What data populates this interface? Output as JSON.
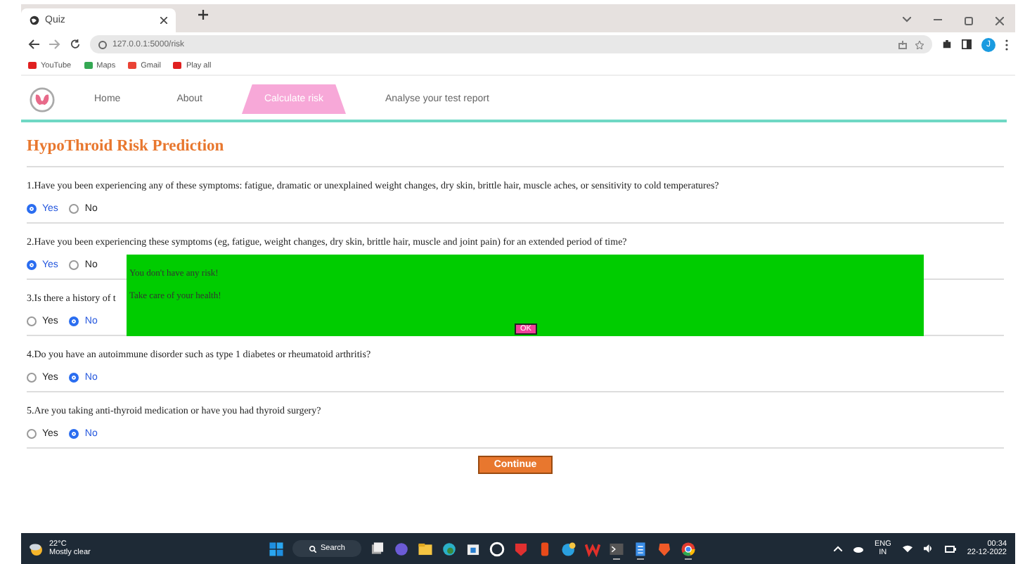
{
  "browser": {
    "tab_title": "Quiz",
    "url": "127.0.0.1:5000/risk",
    "bookmarks": [
      "YouTube",
      "Maps",
      "Gmail",
      "Play all"
    ],
    "profile_initial": "J"
  },
  "nav": {
    "items": [
      {
        "label": "Home",
        "selected": false
      },
      {
        "label": "About",
        "selected": false
      },
      {
        "label": "Calculate risk",
        "selected": true
      },
      {
        "label": "Analyse your test report",
        "selected": false
      }
    ]
  },
  "heading": "HypoThroid Risk Prediction",
  "questions": [
    {
      "text": "1.Have you been experiencing any of these symptoms: fatigue, dramatic or unexplained weight changes, dry skin, brittle hair, muscle aches, or sensitivity to cold temperatures?",
      "options": [
        {
          "label": "Yes",
          "selected": true
        },
        {
          "label": "No",
          "selected": false
        }
      ]
    },
    {
      "text": "2.Have you been experiencing these symptoms (eg, fatigue, weight changes, dry skin, brittle hair, muscle and joint pain) for an extended period of time?",
      "options": [
        {
          "label": "Yes",
          "selected": true
        },
        {
          "label": "No",
          "selected": false
        }
      ]
    },
    {
      "text": "3.Is there a history of t",
      "options": [
        {
          "label": "Yes",
          "selected": false
        },
        {
          "label": "No",
          "selected": true
        }
      ]
    },
    {
      "text": "4.Do you have an autoimmune disorder such as type 1 diabetes or rheumatoid arthritis?",
      "options": [
        {
          "label": "Yes",
          "selected": false
        },
        {
          "label": "No",
          "selected": true
        }
      ]
    },
    {
      "text": "5.Are you taking anti-thyroid medication or have you had thyroid surgery?",
      "options": [
        {
          "label": "Yes",
          "selected": false
        },
        {
          "label": "No",
          "selected": true
        }
      ]
    }
  ],
  "dialog": {
    "lines": [
      "You don't have any risk!",
      "Take care of your health!"
    ],
    "ok_label": "OK"
  },
  "continue_label": "Continue",
  "taskbar": {
    "temperature": "22°C",
    "condition": "Mostly clear",
    "search": "Search",
    "apps": [
      {
        "kind": "start",
        "running": false
      },
      {
        "kind": "files",
        "running": false
      },
      {
        "kind": "chat",
        "running": false
      },
      {
        "kind": "folder",
        "running": false
      },
      {
        "kind": "edge",
        "running": false
      },
      {
        "kind": "store",
        "running": false
      },
      {
        "kind": "circle",
        "running": false
      },
      {
        "kind": "shield",
        "running": false
      },
      {
        "kind": "office",
        "running": false
      },
      {
        "kind": "ball",
        "running": false
      },
      {
        "kind": "wps",
        "running": false
      },
      {
        "kind": "terminal",
        "running": true
      },
      {
        "kind": "notepad",
        "running": true
      },
      {
        "kind": "brave",
        "running": false
      },
      {
        "kind": "chrome",
        "running": true
      }
    ],
    "lang": "ENG",
    "region": "IN",
    "time": "00:34",
    "date": "22-12-2022"
  }
}
